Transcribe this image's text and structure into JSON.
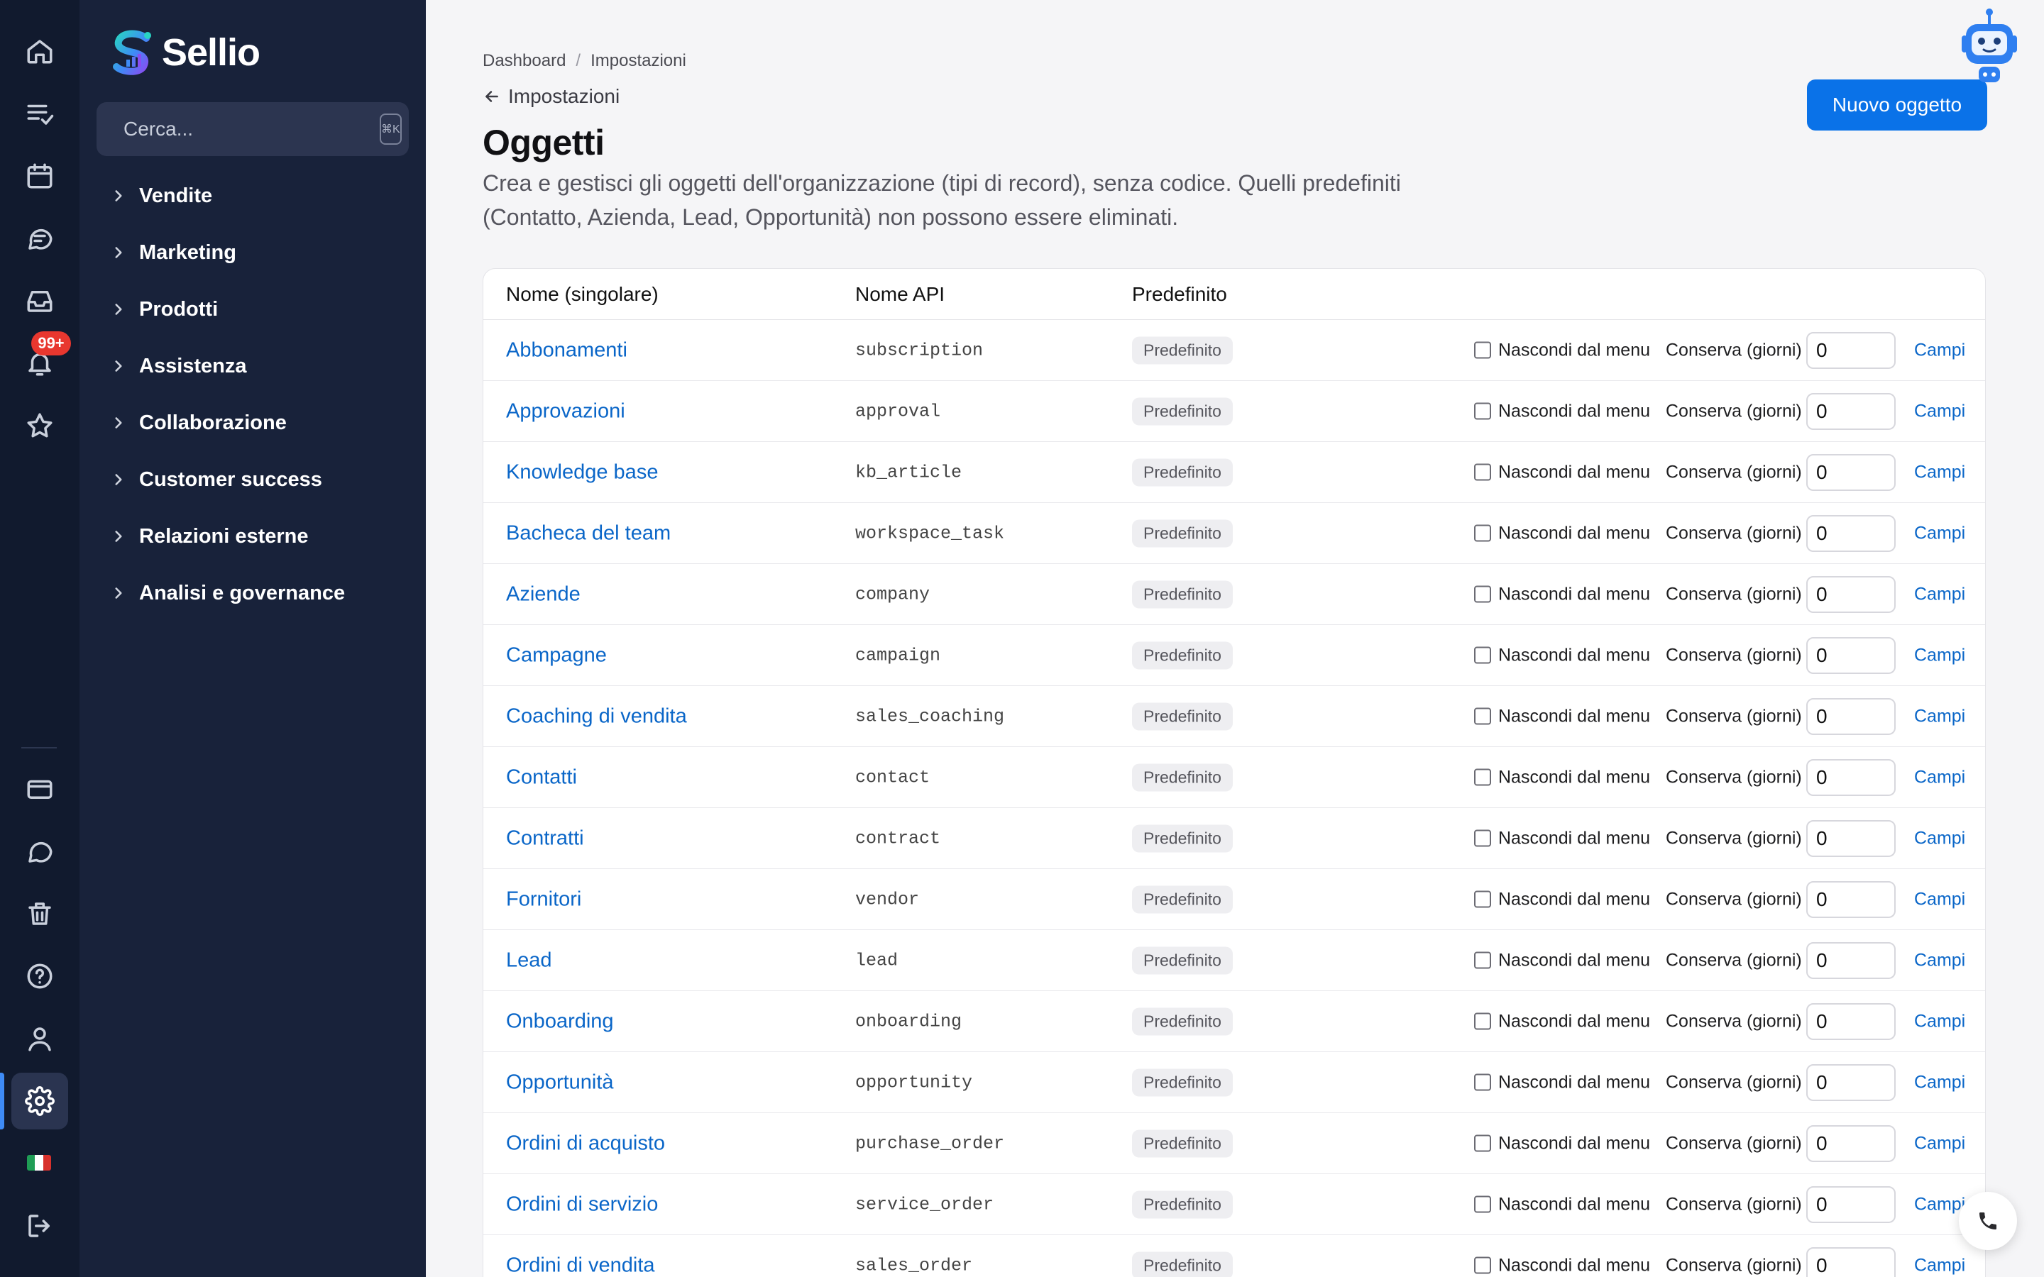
{
  "brand": {
    "name": "Sellio"
  },
  "search": {
    "placeholder": "Cerca...",
    "shortcut": "⌘K"
  },
  "notifications": {
    "badge": "99+"
  },
  "nav": {
    "items": [
      {
        "label": "Vendite"
      },
      {
        "label": "Marketing"
      },
      {
        "label": "Prodotti"
      },
      {
        "label": "Assistenza"
      },
      {
        "label": "Collaborazione"
      },
      {
        "label": "Customer success"
      },
      {
        "label": "Relazioni esterne"
      },
      {
        "label": "Analisi e governance"
      }
    ]
  },
  "breadcrumb": {
    "items": [
      "Dashboard",
      "Impostazioni"
    ],
    "separator": "/"
  },
  "back_link": {
    "label": "Impostazioni"
  },
  "page": {
    "title": "Oggetti",
    "description": "Crea e gestisci gli oggetti dell'organizzazione (tipi di record), senza codice. Quelli predefiniti (Contatto, Azienda, Lead, Opportunità) non possono essere eliminati."
  },
  "actions": {
    "new_object": "Nuovo oggetto"
  },
  "table": {
    "headers": {
      "name": "Nome (singolare)",
      "api": "Nome API",
      "default": "Predefinito"
    },
    "labels": {
      "tag": "Predefinito",
      "hide": "Nascondi dal menu",
      "keep": "Conserva (giorni)",
      "fields": "Campi"
    },
    "rows": [
      {
        "name": "Abbonamenti",
        "api": "subscription",
        "days": "0"
      },
      {
        "name": "Approvazioni",
        "api": "approval",
        "days": "0"
      },
      {
        "name": "Knowledge base",
        "api": "kb_article",
        "days": "0"
      },
      {
        "name": "Bacheca del team",
        "api": "workspace_task",
        "days": "0"
      },
      {
        "name": "Aziende",
        "api": "company",
        "days": "0"
      },
      {
        "name": "Campagne",
        "api": "campaign",
        "days": "0"
      },
      {
        "name": "Coaching di vendita",
        "api": "sales_coaching",
        "days": "0"
      },
      {
        "name": "Contatti",
        "api": "contact",
        "days": "0"
      },
      {
        "name": "Contratti",
        "api": "contract",
        "days": "0"
      },
      {
        "name": "Fornitori",
        "api": "vendor",
        "days": "0"
      },
      {
        "name": "Lead",
        "api": "lead",
        "days": "0"
      },
      {
        "name": "Onboarding",
        "api": "onboarding",
        "days": "0"
      },
      {
        "name": "Opportunità",
        "api": "opportunity",
        "days": "0"
      },
      {
        "name": "Ordini di acquisto",
        "api": "purchase_order",
        "days": "0"
      },
      {
        "name": "Ordini di servizio",
        "api": "service_order",
        "days": "0"
      },
      {
        "name": "Ordini di vendita",
        "api": "sales_order",
        "days": "0"
      }
    ]
  },
  "colors": {
    "accent": "#0a72e8",
    "link": "#0a66c8",
    "rail": "#111a2e",
    "nav": "#18223a",
    "badge": "#e8372f"
  }
}
